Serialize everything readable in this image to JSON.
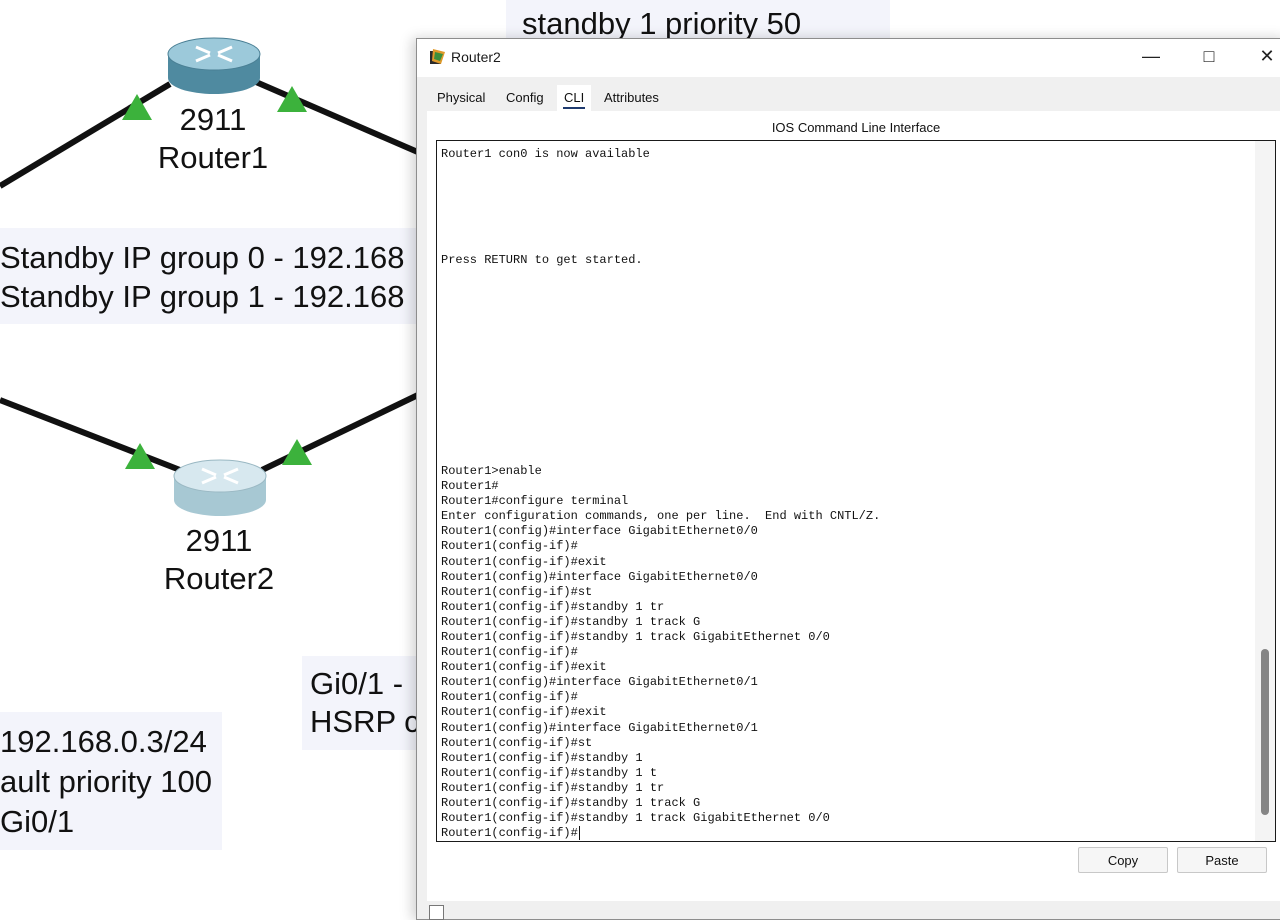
{
  "topology": {
    "devices": [
      {
        "model": "2911",
        "name": "Router1"
      },
      {
        "model": "2911",
        "name": "Router2"
      }
    ],
    "notes": {
      "top_partial": "standby 1 priority 50",
      "standby_group": [
        "Standby IP group 0 - 192.168",
        "Standby IP group 1 - 192.168"
      ],
      "router2_config": [
        "192.168.0.3/24",
        "ault priority 100",
        "Gi0/1"
      ],
      "gi_partial": [
        "Gi0/1 -",
        "HSRP c"
      ]
    }
  },
  "window": {
    "title": "Router2",
    "tabs": [
      "Physical",
      "Config",
      "CLI",
      "Attributes"
    ],
    "active_tab": "CLI",
    "cli_header": "IOS Command Line Interface",
    "console_lines": [
      "Router1 con0 is now available",
      "",
      "",
      "",
      "",
      "",
      "",
      "Press RETURN to get started.",
      "",
      "",
      "",
      "",
      "",
      "",
      "",
      "",
      "",
      "",
      "",
      "",
      "",
      "Router1>enable",
      "Router1#",
      "Router1#configure terminal",
      "Enter configuration commands, one per line.  End with CNTL/Z.",
      "Router1(config)#interface GigabitEthernet0/0",
      "Router1(config-if)#",
      "Router1(config-if)#exit",
      "Router1(config)#interface GigabitEthernet0/0",
      "Router1(config-if)#st",
      "Router1(config-if)#standby 1 tr",
      "Router1(config-if)#standby 1 track G",
      "Router1(config-if)#standby 1 track GigabitEthernet 0/0",
      "Router1(config-if)#",
      "Router1(config-if)#exit",
      "Router1(config)#interface GigabitEthernet0/1",
      "Router1(config-if)#",
      "Router1(config-if)#exit",
      "Router1(config)#interface GigabitEthernet0/1",
      "Router1(config-if)#st",
      "Router1(config-if)#standby 1",
      "Router1(config-if)#standby 1 t",
      "Router1(config-if)#standby 1 tr",
      "Router1(config-if)#standby 1 track G",
      "Router1(config-if)#standby 1 track GigabitEthernet 0/0",
      "Router1(config-if)#"
    ],
    "buttons": {
      "copy": "Copy",
      "paste": "Paste"
    }
  },
  "colors": {
    "link": "#111111",
    "port_up": "#3cb23c",
    "router": "#7fb3c6"
  }
}
